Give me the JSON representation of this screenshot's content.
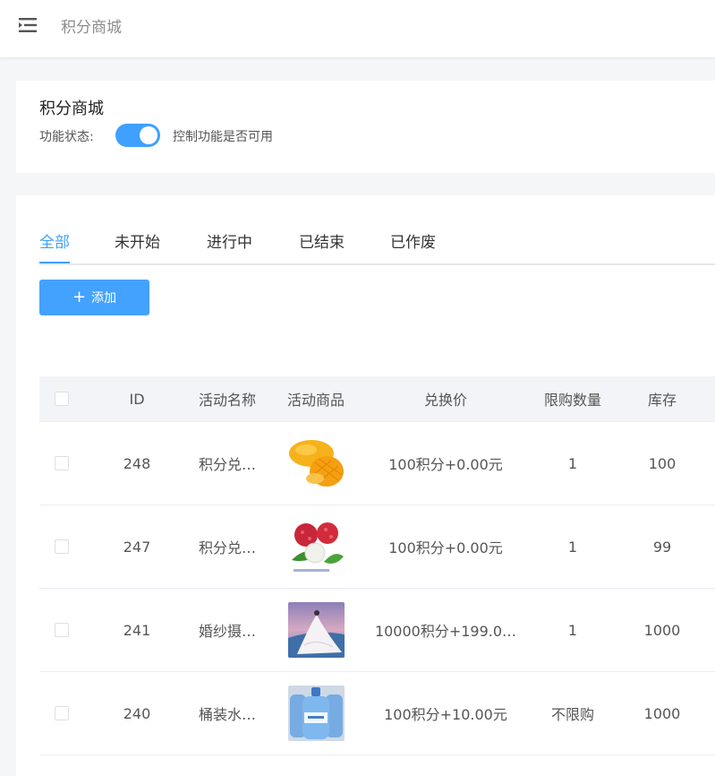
{
  "header": {
    "title": "积分商城",
    "menu_icon": "menu-fold-icon"
  },
  "settings": {
    "title": "积分商城",
    "status_label": "功能状态:",
    "switch_on": true,
    "status_desc": "控制功能是否可用"
  },
  "tabs": [
    {
      "label": "全部",
      "active": true
    },
    {
      "label": "未开始",
      "active": false
    },
    {
      "label": "进行中",
      "active": false
    },
    {
      "label": "已结束",
      "active": false
    },
    {
      "label": "已作废",
      "active": false
    }
  ],
  "add_button": {
    "label": "添加",
    "icon": "plus-icon"
  },
  "table": {
    "headers": {
      "id": "ID",
      "name": "活动名称",
      "goods": "活动商品",
      "price": "兑换价",
      "limit": "限购数量",
      "stock": "库存"
    },
    "rows": [
      {
        "id": "248",
        "name": "积分兑…",
        "goods_image": "mango-image",
        "price": "100积分+0.00元",
        "limit": "1",
        "stock": "100"
      },
      {
        "id": "247",
        "name": "积分兑…",
        "goods_image": "lychee-image",
        "price": "100积分+0.00元",
        "limit": "1",
        "stock": "99"
      },
      {
        "id": "241",
        "name": "婚纱摄…",
        "goods_image": "wedding-photo-image",
        "price": "10000积分+199.0…",
        "limit": "1",
        "stock": "1000"
      },
      {
        "id": "240",
        "name": "桶装水…",
        "goods_image": "bottled-water-image",
        "price": "100积分+10.00元",
        "limit": "不限购",
        "stock": "1000"
      }
    ]
  },
  "colors": {
    "accent": "#3fa0ff",
    "button": "#44a2ff",
    "header_bg": "#f3f4f7",
    "page_bg": "#f5f6f8"
  }
}
